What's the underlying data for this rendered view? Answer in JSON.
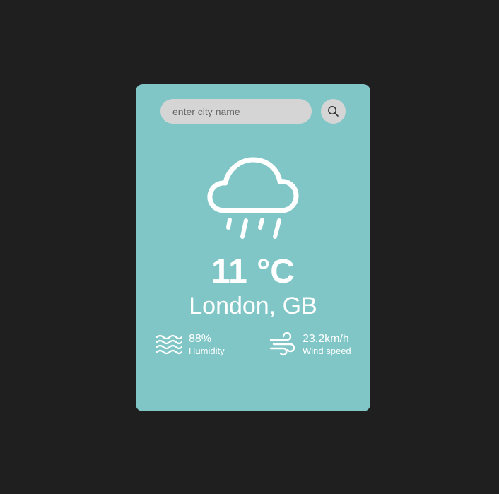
{
  "search": {
    "placeholder": "enter city name",
    "value": ""
  },
  "weather": {
    "condition_icon": "rain-cloud-icon",
    "temperature": "11 °C",
    "location": "London, GB"
  },
  "details": {
    "humidity": {
      "icon": "waves-icon",
      "value": "88%",
      "label": "Humidity"
    },
    "wind": {
      "icon": "wind-icon",
      "value": "23.2km/h",
      "label": "Wind speed"
    }
  },
  "colors": {
    "background": "#1f1f1f",
    "card": "#80c6c7",
    "input": "#d5d5d5",
    "text": "#ffffff"
  }
}
